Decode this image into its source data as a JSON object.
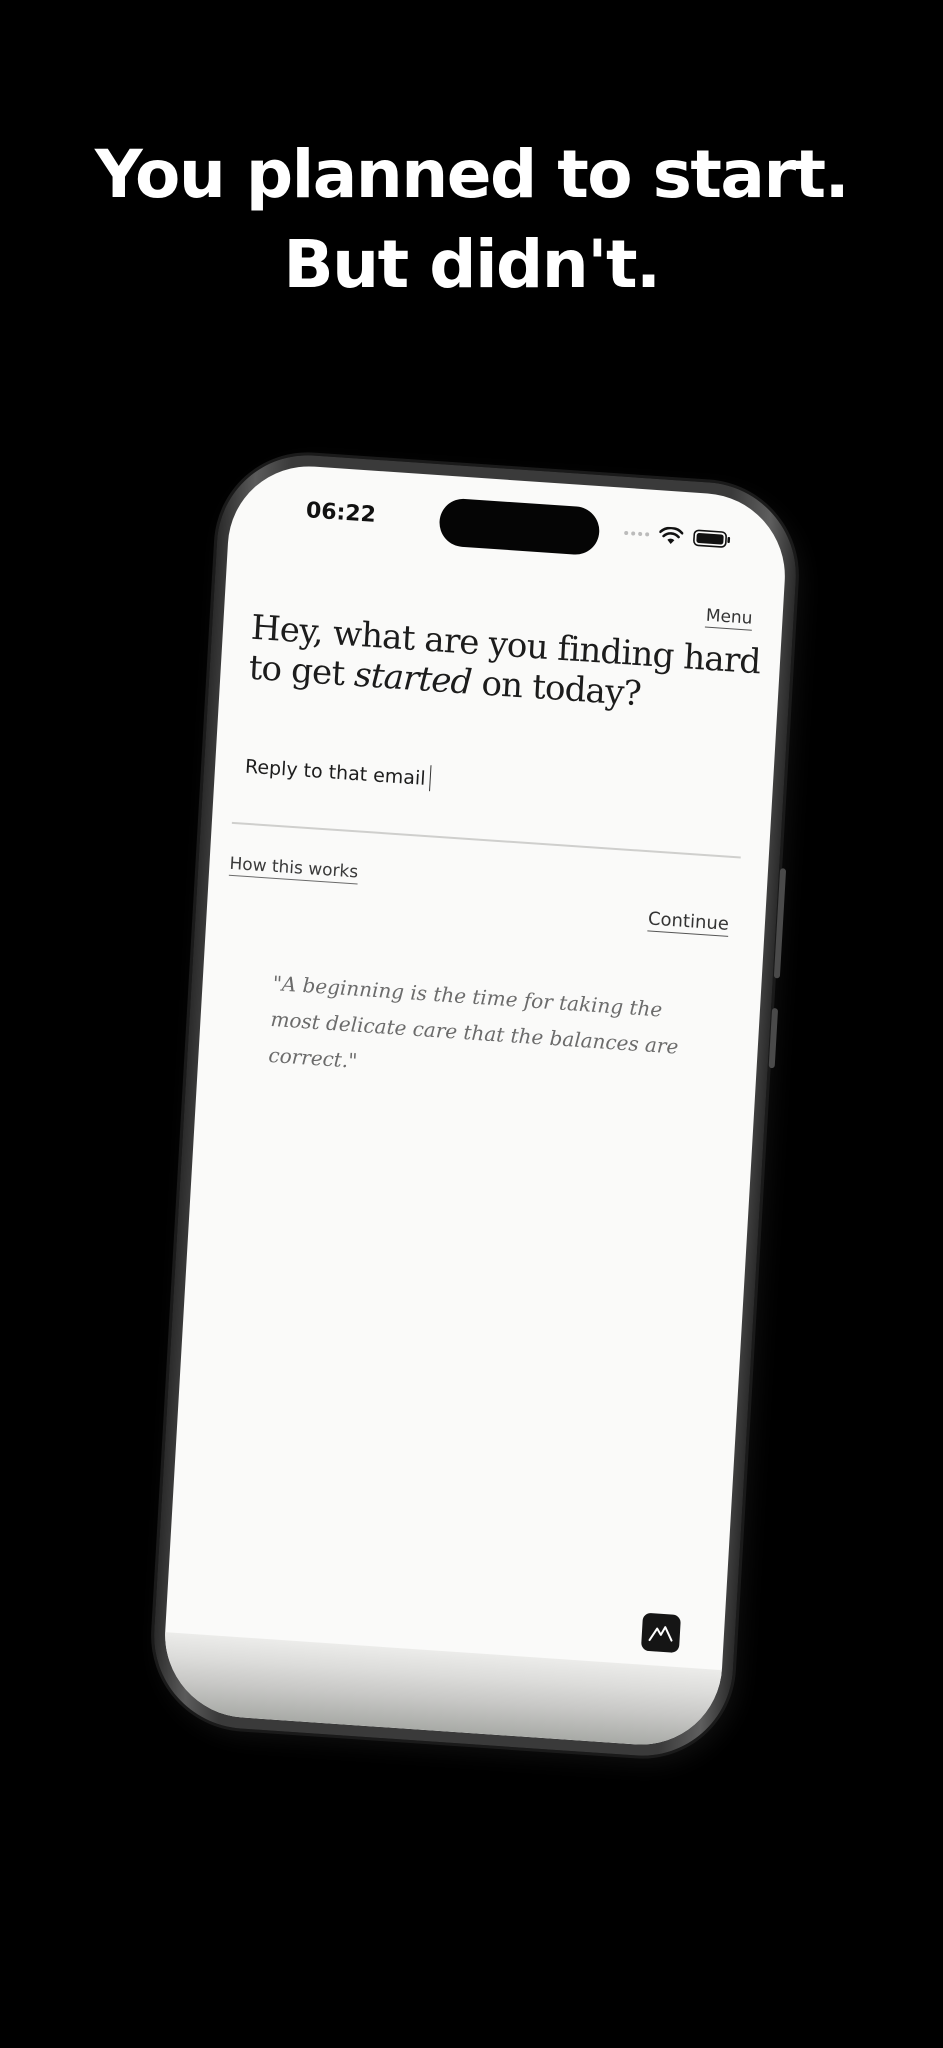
{
  "headline": {
    "line1": "You planned to start.",
    "line2": "But didn't."
  },
  "status_bar": {
    "time": "06:22",
    "icons": [
      "signal-dots-icon",
      "wifi-icon",
      "battery-icon"
    ]
  },
  "screen": {
    "menu_label": "Menu",
    "question_part1": "Hey, what are you finding hard to get ",
    "question_emphasis": "started",
    "question_part2": " on today?",
    "input_value": "Reply to that email",
    "how_it_works_label": "How this works",
    "continue_label": "Continue",
    "quote": "\"A beginning is the time for taking the most delicate care that the balances are correct.\"",
    "app_icon": "mountain-logo-icon"
  },
  "colors": {
    "background": "#000000",
    "screen_bg": "#fafaf9",
    "text": "#1c1c1c",
    "quote_text": "#6b6b6b"
  }
}
